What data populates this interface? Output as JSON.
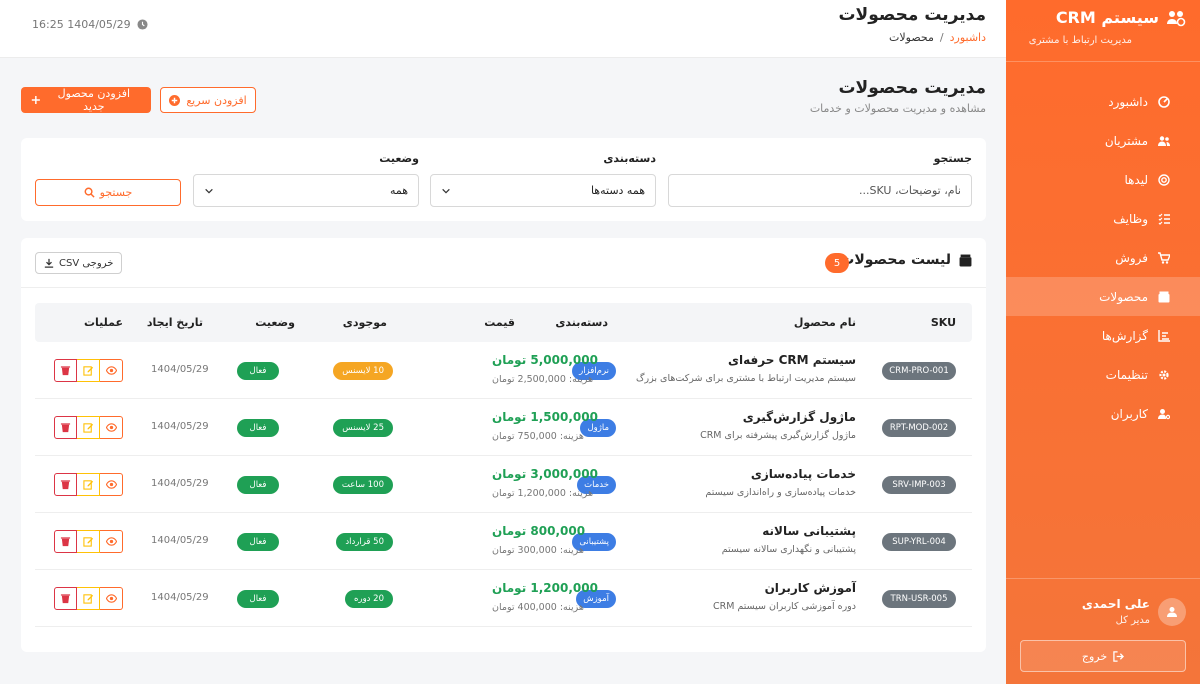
{
  "sidebar": {
    "brand_title": "سیستم CRM",
    "brand_subtitle": "مدیریت ارتباط با مشتری",
    "items": [
      {
        "label": "داشبورد",
        "icon": "dashboard-icon"
      },
      {
        "label": "مشتریان",
        "icon": "users-icon"
      },
      {
        "label": "لیدها",
        "icon": "target-icon"
      },
      {
        "label": "وظایف",
        "icon": "tasks-icon"
      },
      {
        "label": "فروش",
        "icon": "cart-icon"
      },
      {
        "label": "محصولات",
        "icon": "box-icon",
        "active": true
      },
      {
        "label": "گزارش‌ها",
        "icon": "chart-icon"
      },
      {
        "label": "تنظیمات",
        "icon": "gear-icon"
      },
      {
        "label": "کاربران",
        "icon": "user-gear-icon"
      }
    ],
    "user_name": "علی احمدی",
    "user_role": "مدیر کل",
    "logout_label": "خروج"
  },
  "topbar": {
    "title": "مدیریت محصولات",
    "breadcrumb_home": "داشبورد",
    "breadcrumb_sep": "/",
    "breadcrumb_current": "محصولات",
    "datetime": "16:25 1404/05/29"
  },
  "page": {
    "title": "مدیریت محصولات",
    "subtitle": "مشاهده و مدیریت محصولات و خدمات",
    "add_product_label": "افزودن محصول جدید",
    "quick_add_label": "افزودن سریع"
  },
  "filters": {
    "search_label": "جستجو",
    "search_placeholder": "نام، توضیحات، SKU...",
    "category_label": "دسته‌بندی",
    "category_value": "همه دسته‌ها",
    "status_label": "وضعیت",
    "status_value": "همه",
    "search_button": "جستجو"
  },
  "list": {
    "title": "لیست محصولات",
    "count": "5",
    "csv_label": "خروجی CSV",
    "columns": {
      "sku": "SKU",
      "name": "نام محصول",
      "category": "دسته‌بندی",
      "price": "قیمت",
      "stock": "موجودی",
      "status": "وضعیت",
      "created": "تاریخ ایجاد",
      "actions": "عملیات"
    },
    "rows": [
      {
        "sku": "CRM-PRO-001",
        "name": "سیستم CRM حرفه‌ای",
        "desc": "سیستم مدیریت ارتباط با مشتری برای شرکت‌های بزرگ",
        "category": "نرم‌افزار",
        "price": "5,000,000 تومان",
        "cost": "هزینه: 2,500,000 تومان",
        "stock": "10 لایسنس",
        "stock_color": "#f5a623",
        "status": "فعال",
        "date": "1404/05/29"
      },
      {
        "sku": "RPT-MOD-002",
        "name": "ماژول گزارش‌گیری",
        "desc": "ماژول گزارش‌گیری پیشرفته برای CRM",
        "category": "ماژول",
        "price": "1,500,000 تومان",
        "cost": "هزینه: 750,000 تومان",
        "stock": "25 لایسنس",
        "stock_color": "#1fa055",
        "status": "فعال",
        "date": "1404/05/29"
      },
      {
        "sku": "SRV-IMP-003",
        "name": "خدمات پیاده‌سازی",
        "desc": "خدمات پیاده‌سازی و راه‌اندازی سیستم",
        "category": "خدمات",
        "price": "3,000,000 تومان",
        "cost": "هزینه: 1,200,000 تومان",
        "stock": "100 ساعت",
        "stock_color": "#1fa055",
        "status": "فعال",
        "date": "1404/05/29"
      },
      {
        "sku": "SUP-YRL-004",
        "name": "پشتیبانی سالانه",
        "desc": "پشتیبانی و نگهداری سالانه سیستم",
        "category": "پشتیبانی",
        "price": "800,000 تومان",
        "cost": "هزینه: 300,000 تومان",
        "stock": "50 قرارداد",
        "stock_color": "#1fa055",
        "status": "فعال",
        "date": "1404/05/29"
      },
      {
        "sku": "TRN-USR-005",
        "name": "آموزش کاربران",
        "desc": "دوره آموزشی کاربران سیستم CRM",
        "category": "آموزش",
        "price": "1,200,000 تومان",
        "cost": "هزینه: 400,000 تومان",
        "stock": "20 دوره",
        "stock_color": "#1fa055",
        "status": "فعال",
        "date": "1404/05/29"
      }
    ]
  }
}
